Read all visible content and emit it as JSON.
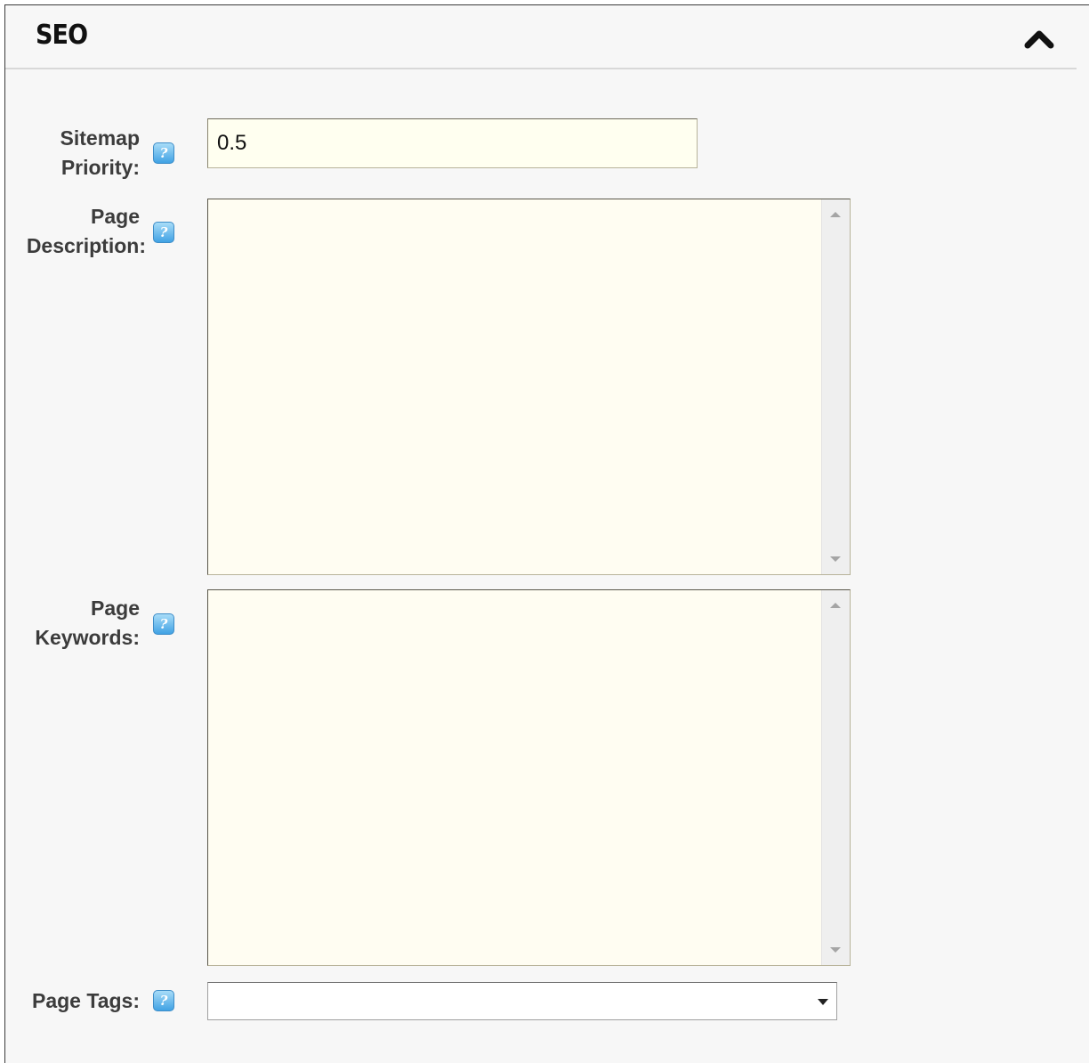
{
  "panel": {
    "title": "SEO",
    "collapse_icon": "chevron-up-icon"
  },
  "fields": {
    "sitemap_priority": {
      "label_line1": "Sitemap",
      "label_line2": "Priority:",
      "value": "0.5",
      "help_icon": "help-icon"
    },
    "page_description": {
      "label_line1": "Page",
      "label_line2": "Description:",
      "value": "",
      "help_icon": "help-icon"
    },
    "page_keywords": {
      "label_line1": "Page",
      "label_line2": "Keywords:",
      "value": "",
      "help_icon": "help-icon"
    },
    "page_tags": {
      "label": "Page Tags:",
      "selected": "",
      "help_icon": "help-icon"
    }
  },
  "help_glyph": "?",
  "colors": {
    "input_background": "#fffff0",
    "panel_background": "#f7f7f7",
    "help_icon_blue": "#41a2e4"
  }
}
